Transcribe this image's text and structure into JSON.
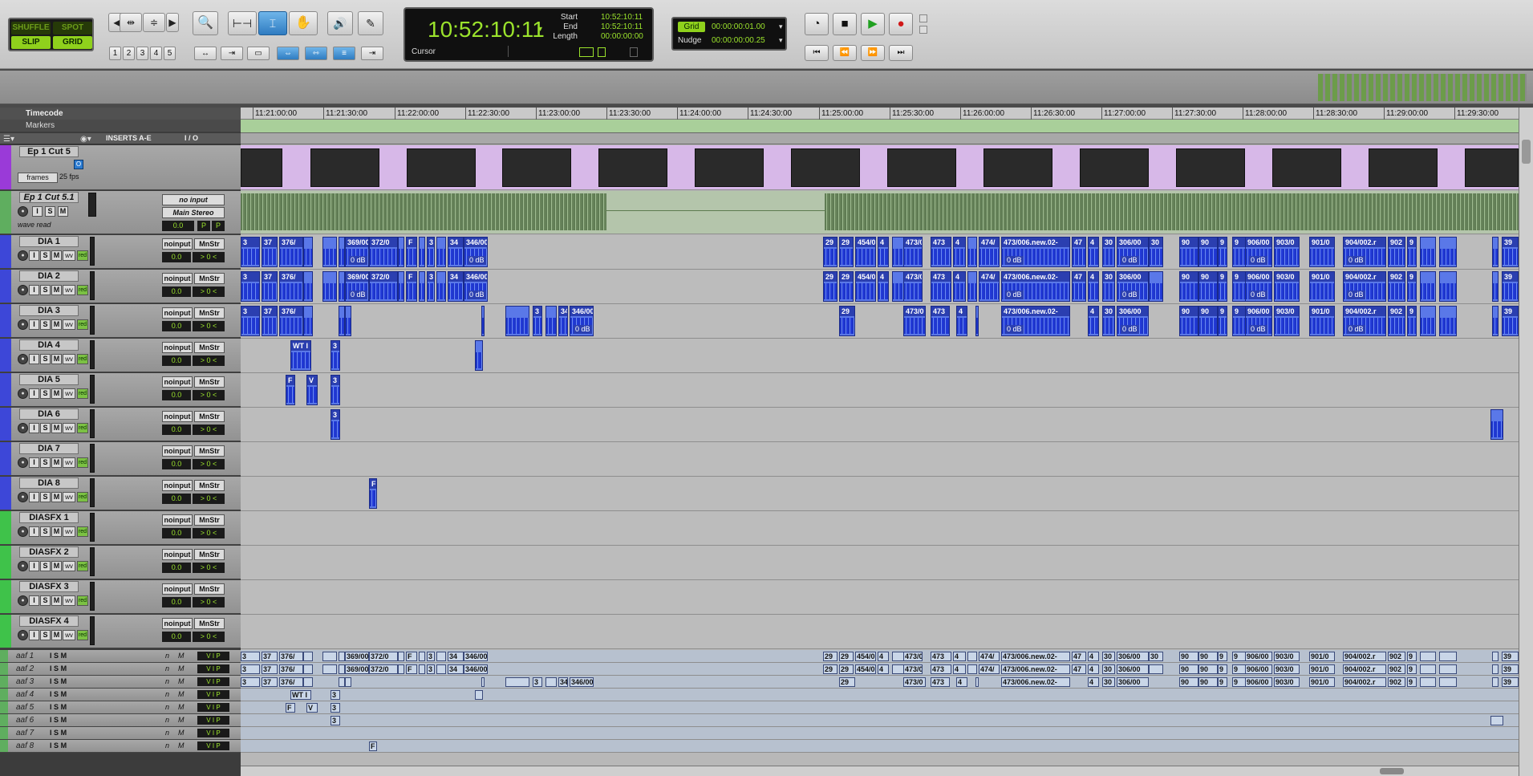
{
  "toolbar": {
    "modes": [
      "SHUFFLE",
      "SPOT",
      "SLIP",
      "GRID"
    ],
    "zoom_presets": [
      "1",
      "2",
      "3",
      "4",
      "5"
    ],
    "counter": {
      "main": "10:52:10:11",
      "start_label": "Start",
      "end_label": "End",
      "length_label": "Length",
      "start": "10:52:10:11",
      "end": "10:52:10:11",
      "length": "00:00:00:00",
      "cursor_label": "Cursor"
    },
    "grid": {
      "grid_label": "Grid",
      "grid_value": "00:00:00:01.00",
      "nudge_label": "Nudge",
      "nudge_value": "00:00:00:00.25"
    }
  },
  "ruler": {
    "timecode_label": "Timecode",
    "markers_label": "Markers",
    "ticks": [
      "11:21:00:00",
      "11:21:30:00",
      "11:22:00:00",
      "11:22:30:00",
      "11:23:00:00",
      "11:23:30:00",
      "11:24:00:00",
      "11:24:30:00",
      "11:25:00:00",
      "11:25:30:00",
      "11:26:00:00",
      "11:26:30:00",
      "11:27:00:00",
      "11:27:30:00",
      "11:28:00:00",
      "11:28:30:00",
      "11:29:00:00",
      "11:29:30:00"
    ]
  },
  "columns": {
    "inserts": "INSERTS A-E",
    "io": "I / O"
  },
  "video_track": {
    "name": "Ep 1 Cut 5",
    "rate_mode": "frames",
    "fps": "25 fps"
  },
  "stereo_track": {
    "name": "Ep 1 Cut 5.1",
    "input": "no input",
    "output": "Main Stereo",
    "auto": "wave read",
    "volume": "0.0",
    "pan_l": "P",
    "pan_r": "P"
  },
  "common": {
    "noinput": "noinput",
    "mnstr": "MnStr",
    "vol": "0.0",
    "pan": "> 0 <",
    "wv": "wv",
    "red": "red",
    "i": "I",
    "s": "S",
    "m": "M",
    "zero_db": "0 dB",
    "n": "n",
    "vip_v": "V",
    "vip_i": "I",
    "vip_p": "P"
  },
  "tracks": [
    {
      "name": "DIA 1",
      "color": "#3d47d8"
    },
    {
      "name": "DIA 2",
      "color": "#3d47d8"
    },
    {
      "name": "DIA 3",
      "color": "#3d47d8"
    },
    {
      "name": "DIA 4",
      "color": "#3d47d8"
    },
    {
      "name": "DIA 5",
      "color": "#3d47d8"
    },
    {
      "name": "DIA 6",
      "color": "#3d47d8"
    },
    {
      "name": "DIA 7",
      "color": "#3d47d8"
    },
    {
      "name": "DIA 8",
      "color": "#3d47d8"
    },
    {
      "name": "DIASFX 1",
      "color": "#3fc24a"
    },
    {
      "name": "DIASFX 2",
      "color": "#3fc24a"
    },
    {
      "name": "DIASFX 3",
      "color": "#3fc24a"
    },
    {
      "name": "DIASFX 4",
      "color": "#3fc24a"
    }
  ],
  "clip_labels": {
    "c1": "3",
    "c2": "37",
    "c3": "376/",
    "c4": "369/004.",
    "c5": "372/0",
    "c6": "F",
    "c7": "3",
    "c8": "34",
    "c9": "346/00",
    "c10": "29",
    "c11": "29",
    "c12": "454/0",
    "c13": "4",
    "c14": "473/0",
    "c15": "473",
    "c16": "4",
    "c17": "474/",
    "c18": "473/006.new.02-",
    "c19": "47",
    "c20": "4",
    "c21": "30",
    "c22": "306/00",
    "c23": "30",
    "c24": "90",
    "c25": "90",
    "c26": "9",
    "c27": "9",
    "c28": "906/00",
    "c29": "903/0",
    "c30": "901/0",
    "c31": "904/002.r",
    "c32": "902",
    "c33": "9",
    "c34": "39",
    "wt": "WT I",
    "v": "V"
  },
  "aaf_tracks": [
    "aaf 1",
    "aaf 2",
    "aaf 3",
    "aaf 4",
    "aaf 5",
    "aaf 6",
    "aaf 7",
    "aaf 8"
  ]
}
